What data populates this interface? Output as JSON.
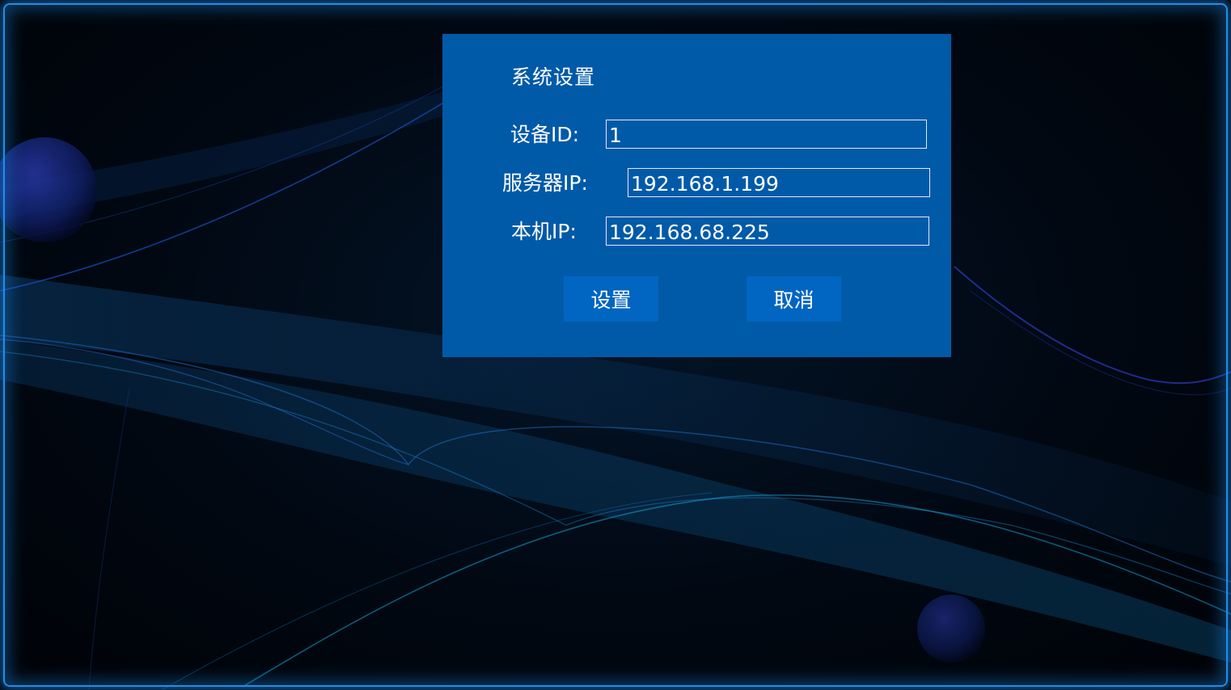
{
  "dialog": {
    "title": "系统设置",
    "fields": [
      {
        "label": "设备ID:",
        "value": "1"
      },
      {
        "label": "服务器IP:",
        "value": "192.168.1.199"
      },
      {
        "label": "本机IP:",
        "value": "192.168.68.225"
      }
    ],
    "buttons": {
      "confirm_label": "设置",
      "cancel_label": "取消"
    }
  },
  "colors": {
    "dialog_background": "#015aa8",
    "button_background": "#0165c2",
    "frame_glow": "#1f8fe8",
    "screen_background": "#000611"
  }
}
